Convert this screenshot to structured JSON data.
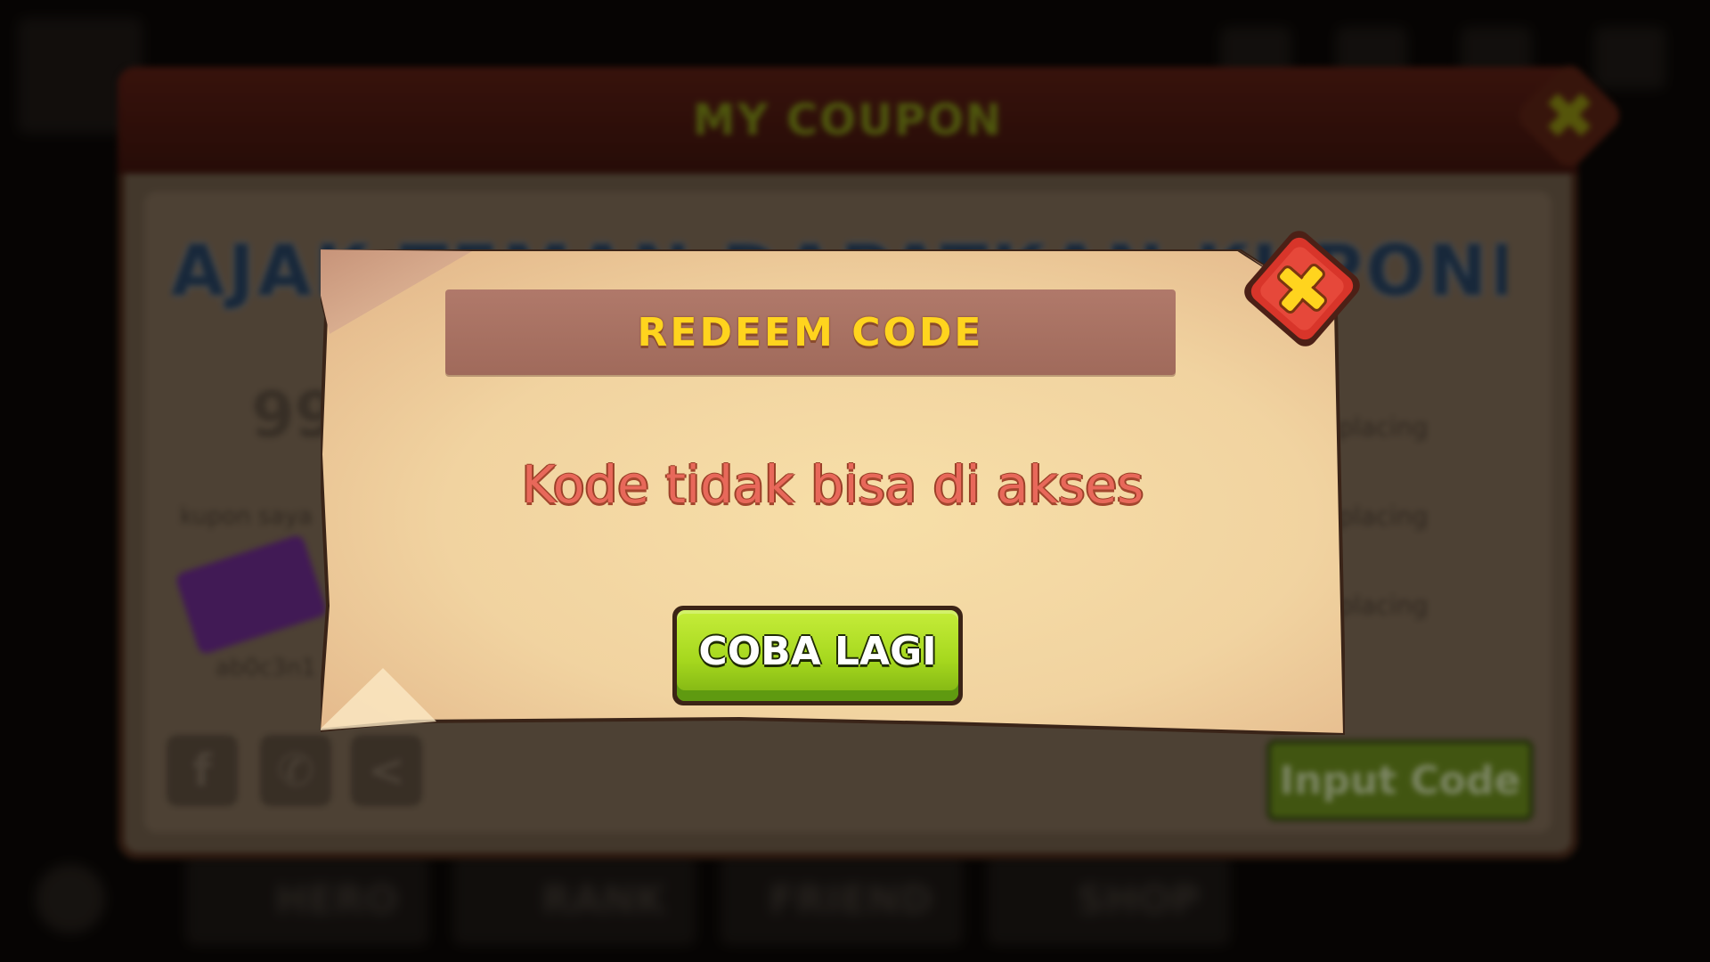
{
  "background": {
    "coupon_window": {
      "title": "MY COUPON",
      "banner_text": "AJAK TEMAN DAPATKAN KUPONNYA!!",
      "coupon_count": "99",
      "kupon_label": "kupon saya",
      "code_label": "ab0c3n1",
      "list_items": [
        "placing",
        "placing",
        "placing"
      ],
      "input_code_label": "Input Code",
      "social_icons": [
        "facebook-icon",
        "whatsapp-icon",
        "share-icon"
      ]
    },
    "bottom_nav": [
      "HERO",
      "RANK",
      "FRIEND",
      "SHOP"
    ]
  },
  "modal": {
    "title": "REDEEM CODE",
    "message": "Kode tidak bisa di akses",
    "retry_label": "COBA LAGI",
    "close_icon": "close-icon"
  },
  "colors": {
    "title_yellow": "#ffd41e",
    "message_red": "#e8685a",
    "button_green": "#a6d81e",
    "close_red": "#d8352a",
    "paper": "#f3d9a8"
  }
}
